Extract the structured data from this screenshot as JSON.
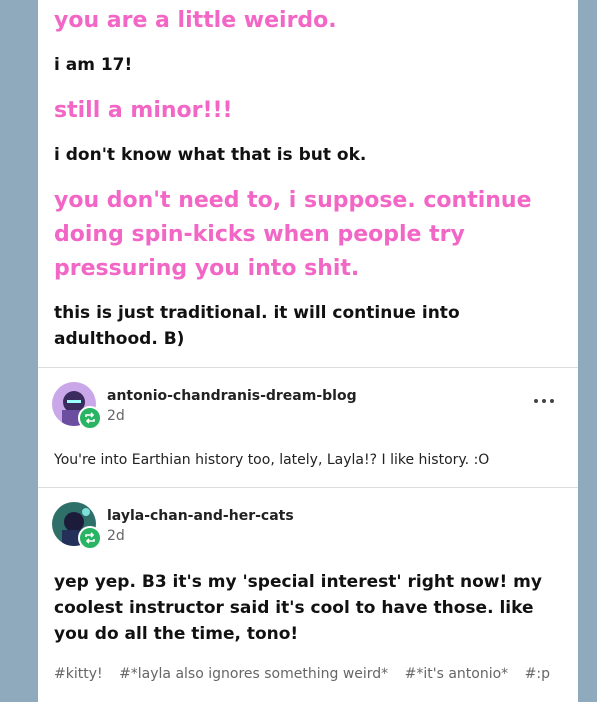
{
  "conversation": [
    {
      "style": "pink",
      "text": "you are a little weirdo."
    },
    {
      "style": "black",
      "text": "i am 17!"
    },
    {
      "style": "pink",
      "text": "still a minor!!!"
    },
    {
      "style": "black",
      "text": "i don't know what that is but ok."
    },
    {
      "style": "pink",
      "text": "you don't need to, i suppose. continue doing spin-kicks when people try pressuring you into shit."
    },
    {
      "style": "black",
      "text": "this is just traditional. it will continue into adulthood. B)"
    }
  ],
  "reblog1": {
    "username": "antonio-chandranis-dream-blog",
    "time": "2d",
    "body": "You're into Earthian history too, lately, Layla!? I like history.  :O"
  },
  "reblog2": {
    "username": "layla-chan-and-her-cats",
    "time": "2d",
    "body": "yep yep. B3 it's my 'special interest' right now! my coolest instructor said it's cool to have those. like you do all the time, tono!"
  },
  "tags": [
    "#kitty!",
    "#*layla also ignores something weird*",
    "#*it's antonio*",
    "#:p"
  ],
  "colors": {
    "accent_pink": "#f266c5",
    "reblog_green": "#28b463",
    "background": "#8fa9bd"
  }
}
